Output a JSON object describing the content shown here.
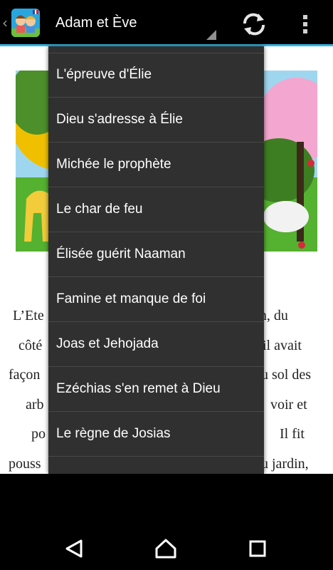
{
  "action_bar": {
    "title": "Adam et Ève",
    "icons": [
      "up-caret-icon",
      "app-logo-icon",
      "refresh-icon",
      "overflow-menu-icon"
    ]
  },
  "content": {
    "image": "illustration-garden-animals",
    "text_lines": [
      [
        "L’Ete",
        "den, du"
      ],
      [
        "côté",
        "il avait"
      ],
      [
        "façon",
        "u sol des"
      ],
      [
        "arb",
        "voir et"
      ],
      [
        "po",
        "Il fit"
      ],
      [
        "pouss",
        "u jardin,"
      ]
    ]
  },
  "dropdown": {
    "items": [
      "L'épreuve d'Élie",
      "Dieu s'adresse à Élie",
      "Michée le prophète",
      "Le char de feu",
      "Élisée guérit Naaman",
      "Famine et manque de foi",
      "Joas et Jehojada",
      "Ezéchias s'en remet à Dieu",
      "Le règne de Josias"
    ]
  },
  "nav_bar": {
    "icons": [
      "back-icon",
      "home-icon",
      "recents-icon"
    ]
  },
  "colors": {
    "accent": "#33b5e5",
    "dropdown_bg": "#303030",
    "divider": "#484848"
  }
}
